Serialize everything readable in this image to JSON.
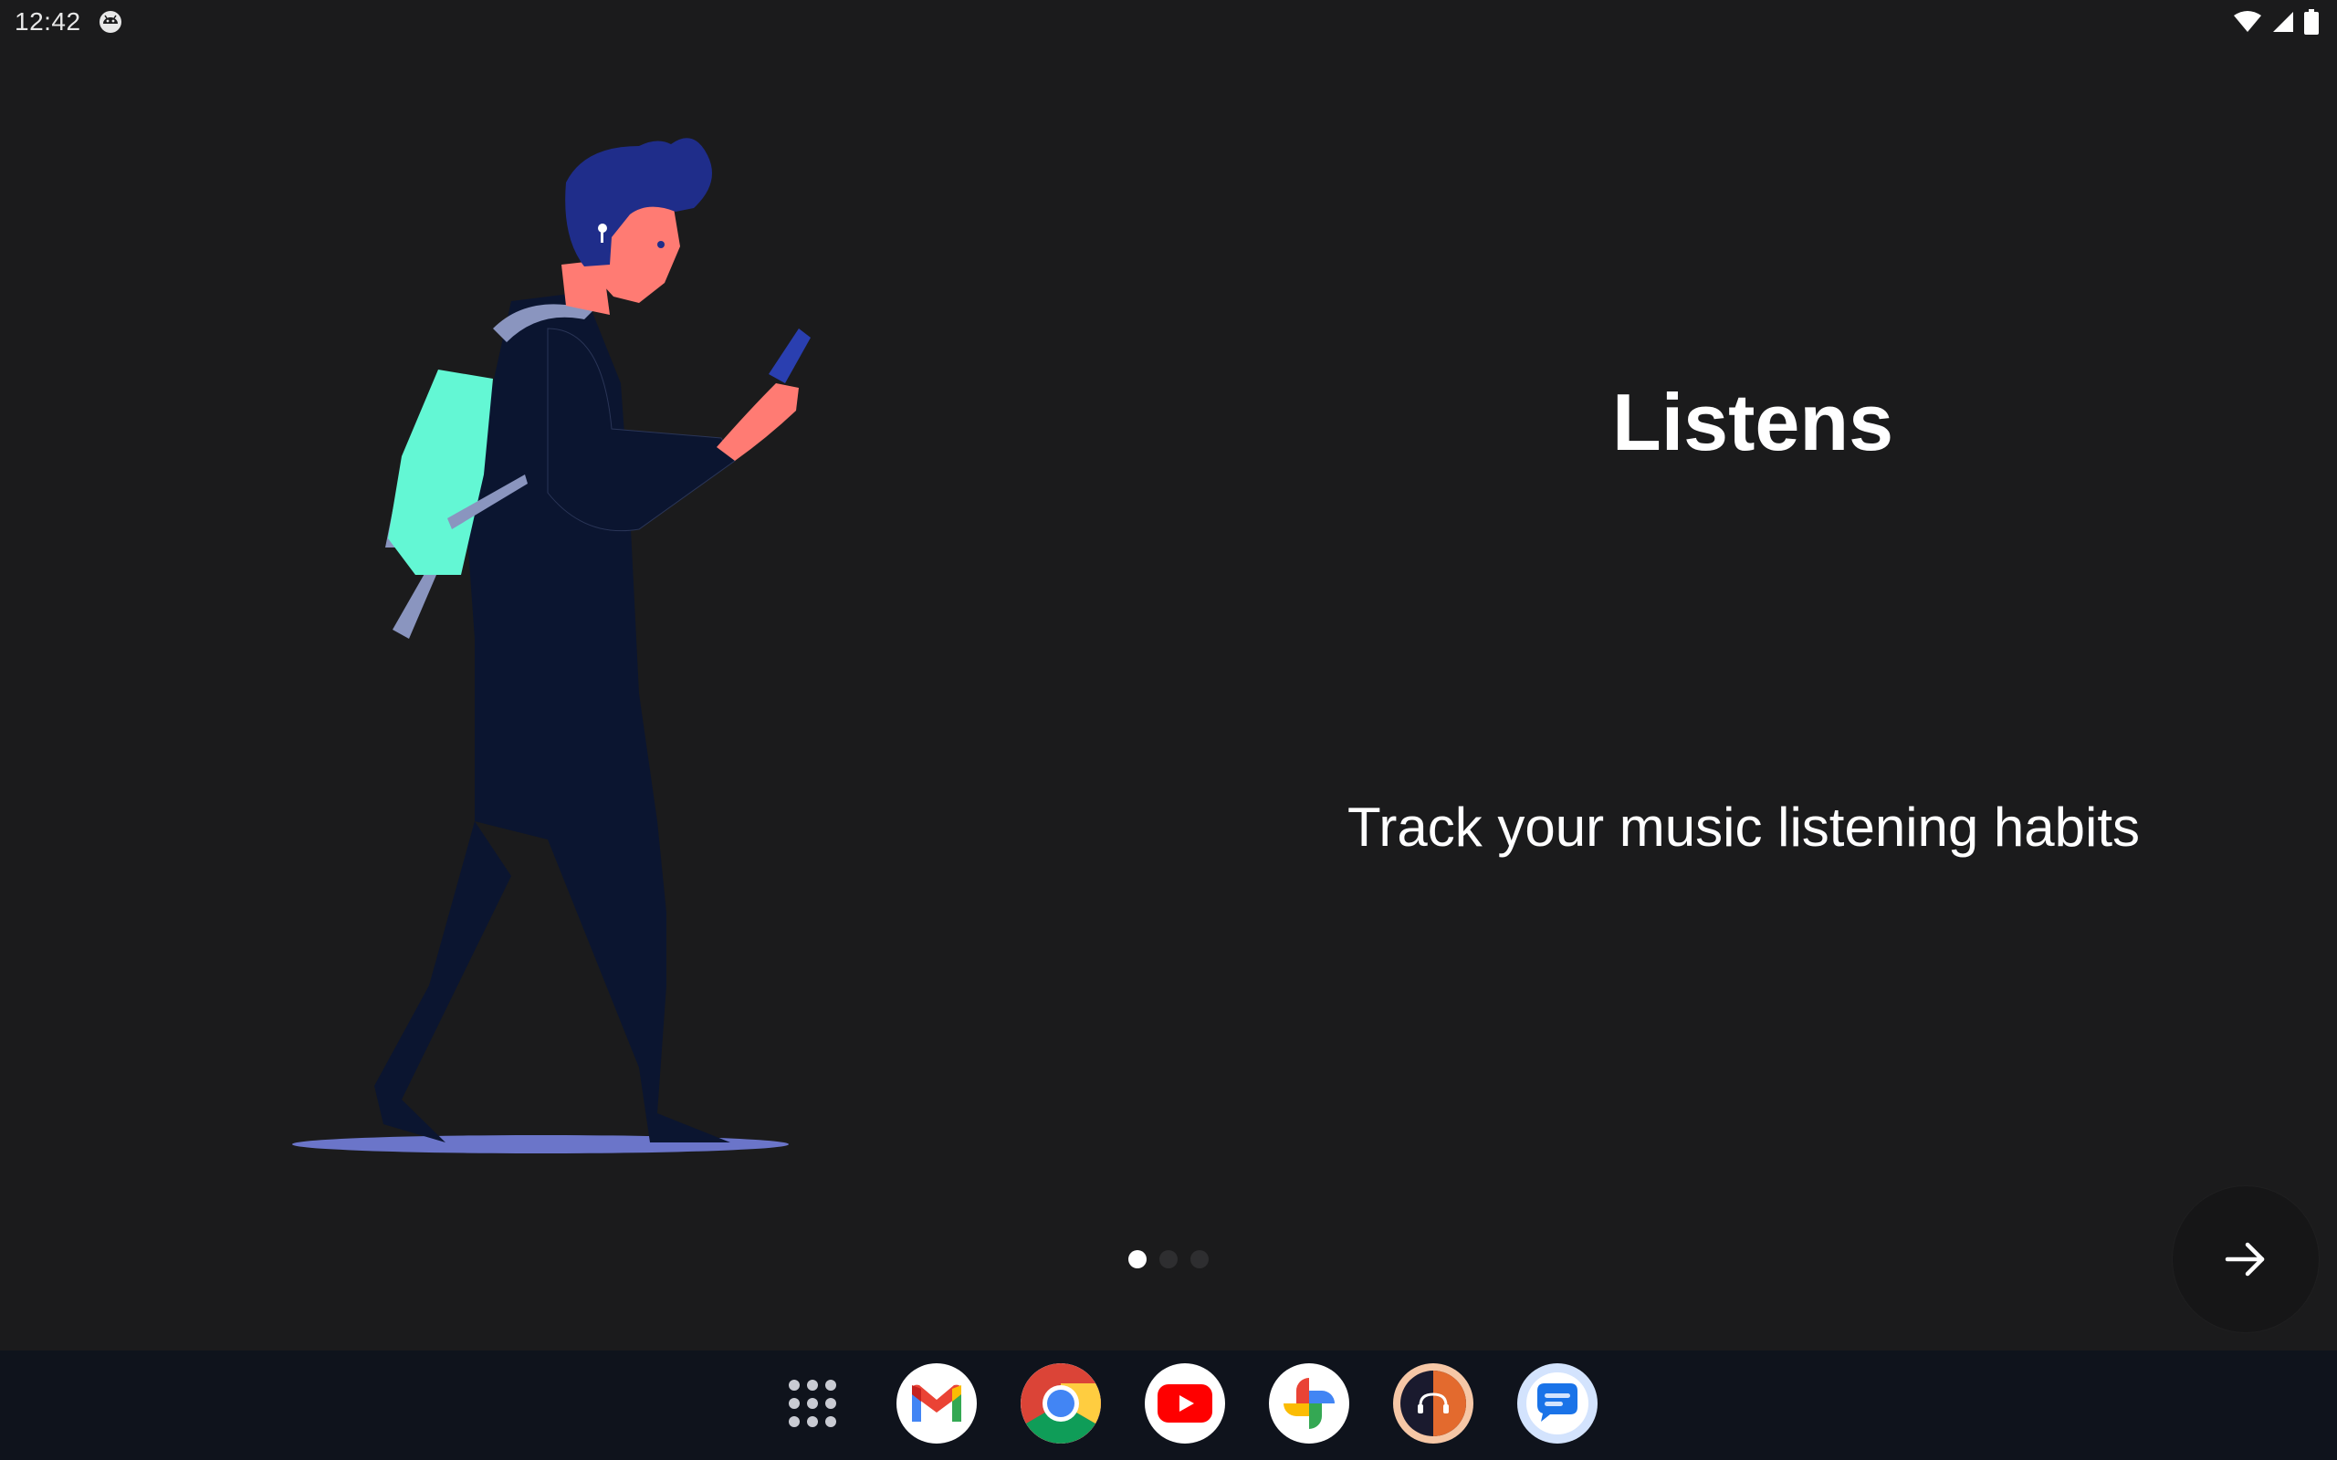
{
  "status_bar": {
    "time": "12:42",
    "notification_icon": "android-debug-icon",
    "icons": [
      "wifi-icon",
      "cellular-signal-icon",
      "battery-icon"
    ]
  },
  "onboarding": {
    "title": "Listens",
    "subtitle": "Track your music listening habits",
    "illustration": "person-walking-with-phone-and-backpack-illustration",
    "pages": 3,
    "current_page": 1,
    "next_button_icon": "arrow-right-icon"
  },
  "taskbar": {
    "apps": [
      "app-drawer-icon",
      "gmail-icon",
      "chrome-icon",
      "youtube-icon",
      "photos-icon",
      "listens-app-icon",
      "messages-icon"
    ]
  },
  "colors": {
    "background": "#1b1b1c",
    "taskbar": "#0f131c",
    "accent_mint": "#63f7d4",
    "skin": "#ff7b73",
    "hair": "#1f2d8a",
    "shadow": "#6b75c9"
  }
}
